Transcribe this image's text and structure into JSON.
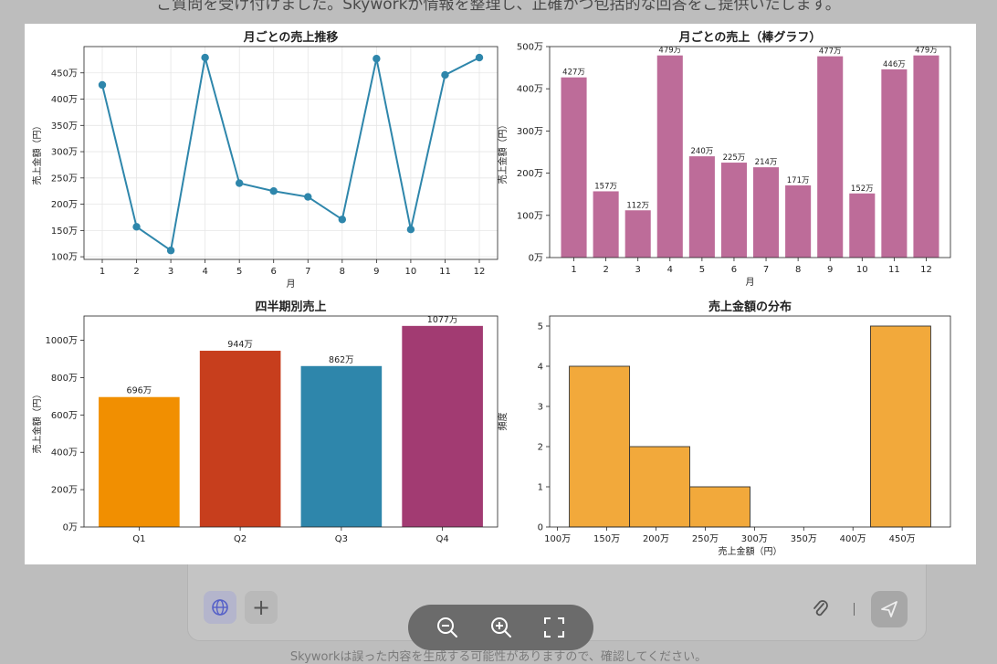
{
  "background": {
    "top_text": "ご質問を受け付けました。Skyworkが情報を整理し、正確かつ包括的な回答をご提供いたします。",
    "bottom_note": "Skyworkは誤った内容を生成する可能性がありますので、確認してください。"
  },
  "toolbar": {
    "globe_icon": "globe-icon",
    "plus_icon": "plus-icon",
    "plus_label": "+",
    "attach_icon": "paperclip-icon",
    "send_icon": "send-icon"
  },
  "zoom": {
    "zoom_out_icon": "zoom-out-icon",
    "zoom_in_icon": "zoom-in-icon",
    "fullscreen_icon": "fullscreen-icon"
  },
  "colors": {
    "line": "#2e86ab",
    "bar_monthly": "#bd6c99",
    "quarters": [
      "#f18f01",
      "#c73e1d",
      "#2e86ab",
      "#a23b72"
    ],
    "hist": "#f2a93b"
  },
  "chart_data": [
    {
      "type": "line",
      "title": "月ごとの売上推移",
      "xlabel": "月",
      "ylabel": "売上金額（円）",
      "x": [
        1,
        2,
        3,
        4,
        5,
        6,
        7,
        8,
        9,
        10,
        11,
        12
      ],
      "values": [
        427,
        157,
        112,
        479,
        240,
        225,
        214,
        171,
        477,
        152,
        446,
        479
      ],
      "unit": "万",
      "ylim": [
        95,
        500
      ],
      "yticks": [
        100,
        150,
        200,
        250,
        300,
        350,
        400,
        450
      ],
      "ytick_labels": [
        "100万",
        "150万",
        "200万",
        "250万",
        "300万",
        "350万",
        "400万",
        "450万"
      ],
      "xticks": [
        "1",
        "2",
        "3",
        "4",
        "5",
        "6",
        "7",
        "8",
        "9",
        "10",
        "11",
        "12"
      ],
      "grid": true
    },
    {
      "type": "bar",
      "title": "月ごとの売上（棒グラフ）",
      "xlabel": "月",
      "ylabel": "売上金額（円）",
      "categories": [
        "1",
        "2",
        "3",
        "4",
        "5",
        "6",
        "7",
        "8",
        "9",
        "10",
        "11",
        "12"
      ],
      "values": [
        427,
        157,
        112,
        479,
        240,
        225,
        214,
        171,
        477,
        152,
        446,
        479
      ],
      "data_labels": [
        "427万",
        "157万",
        "112万",
        "479万",
        "240万",
        "225万",
        "214万",
        "171万",
        "477万",
        "152万",
        "446万",
        "479万"
      ],
      "ylim": [
        0,
        500
      ],
      "yticks": [
        0,
        100,
        200,
        300,
        400,
        500
      ],
      "ytick_labels": [
        "0万",
        "100万",
        "200万",
        "300万",
        "400万",
        "500万"
      ],
      "grid": false
    },
    {
      "type": "bar",
      "title": "四半期別売上",
      "xlabel": "",
      "ylabel": "売上金額（円）",
      "categories": [
        "Q1",
        "Q2",
        "Q3",
        "Q4"
      ],
      "values": [
        696,
        944,
        862,
        1077
      ],
      "data_labels": [
        "696万",
        "944万",
        "862万",
        "1077万"
      ],
      "ylim": [
        0,
        1130
      ],
      "yticks": [
        0,
        200,
        400,
        600,
        800,
        1000
      ],
      "ytick_labels": [
        "0万",
        "200万",
        "400万",
        "600万",
        "800万",
        "1000万"
      ],
      "grid": false
    },
    {
      "type": "bar",
      "subtype": "histogram",
      "title": "売上金額の分布",
      "xlabel": "売上金額（円）",
      "ylabel": "頻度",
      "bins": [
        [
          112,
          173.2
        ],
        [
          173.2,
          234.3
        ],
        [
          234.3,
          295.5
        ],
        [
          295.5,
          356.7
        ],
        [
          356.7,
          417.8
        ],
        [
          417.8,
          479
        ]
      ],
      "values": [
        4,
        2,
        1,
        0,
        0,
        5
      ],
      "xlim": [
        92,
        499
      ],
      "ylim": [
        0,
        5.25
      ],
      "xticks": [
        100,
        150,
        200,
        250,
        300,
        350,
        400,
        450
      ],
      "xtick_labels": [
        "100万",
        "150万",
        "200万",
        "250万",
        "300万",
        "350万",
        "400万",
        "450万"
      ],
      "yticks": [
        0,
        1,
        2,
        3,
        4,
        5
      ],
      "ytick_labels": [
        "0",
        "1",
        "2",
        "3",
        "4",
        "5"
      ],
      "grid": false
    }
  ]
}
